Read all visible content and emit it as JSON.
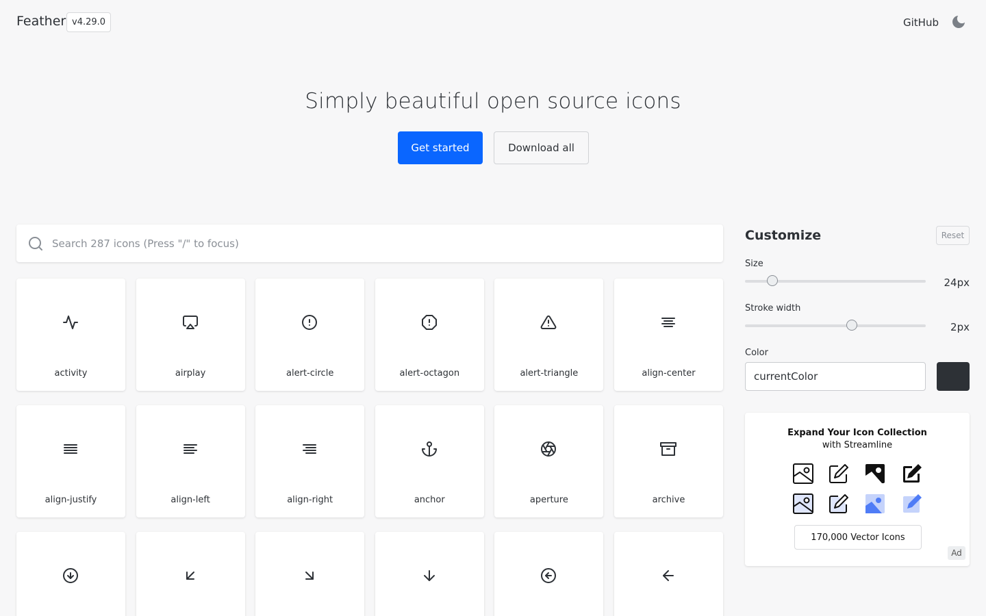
{
  "header": {
    "brand": "Feather",
    "version": "v4.29.0",
    "github_label": "GitHub",
    "theme_icon": "moon-icon"
  },
  "hero": {
    "title": "Simply beautiful open source icons",
    "primary_button": "Get started",
    "secondary_button": "Download all"
  },
  "search": {
    "placeholder": "Search 287 icons (Press \"/\" to focus)",
    "value": "",
    "icon": "search-icon"
  },
  "icons": [
    {
      "name": "activity"
    },
    {
      "name": "airplay"
    },
    {
      "name": "alert-circle"
    },
    {
      "name": "alert-octagon"
    },
    {
      "name": "alert-triangle"
    },
    {
      "name": "align-center"
    },
    {
      "name": "align-justify"
    },
    {
      "name": "align-left"
    },
    {
      "name": "align-right"
    },
    {
      "name": "anchor"
    },
    {
      "name": "aperture"
    },
    {
      "name": "archive"
    },
    {
      "name": "arrow-down-circle"
    },
    {
      "name": "arrow-down-left"
    },
    {
      "name": "arrow-down-right"
    },
    {
      "name": "arrow-down"
    },
    {
      "name": "arrow-left-circle"
    },
    {
      "name": "arrow-left"
    }
  ],
  "customize": {
    "title": "Customize",
    "reset_label": "Reset",
    "size": {
      "label": "Size",
      "value": "24px",
      "fraction": 0.15
    },
    "stroke": {
      "label": "Stroke width",
      "value": "2px",
      "fraction": 0.59
    },
    "color": {
      "label": "Color",
      "value": "currentColor",
      "swatch": "#2d3136"
    }
  },
  "ad": {
    "title": "Expand Your Icon Collection",
    "subtitle": "with Streamline",
    "button": "170,000 Vector Icons",
    "tag": "Ad",
    "accent": "#4f7cf6"
  },
  "colors": {
    "primary": "#0a66ff",
    "background": "#f7f7f8",
    "text": "#2d3136"
  }
}
